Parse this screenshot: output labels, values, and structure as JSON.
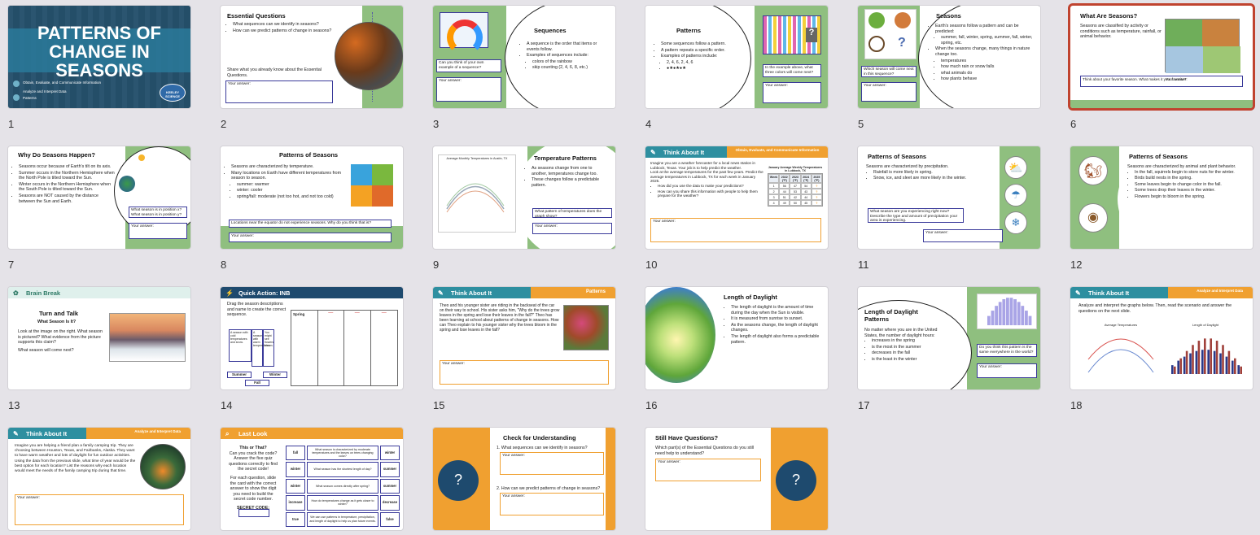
{
  "slides": [
    {
      "n": "1",
      "title": "PATTERNS OF CHANGE IN SEASONS",
      "std": "Obtain, Evaluate, and Communicate Information",
      "std2": "Analyze and Interpret Data",
      "std3": "Patterns",
      "logo": "KEELEY SCIENCE"
    },
    {
      "n": "2",
      "title": "Essential Questions",
      "b1": "What sequences can we identify in seasons?",
      "b2": "How can we predict patterns of change in seasons?",
      "p": "Share what you already know about the Essential Questions.",
      "ans": "Your answer:"
    },
    {
      "n": "3",
      "title": "Sequences",
      "b1": "A sequence is the order that items or events follow.",
      "b2": "Examples of sequences include:",
      "b3": "colors of the rainbow",
      "b4": "skip counting (2, 4, 6, 8, etc.)",
      "q": "Can you think of your own example of a sequence?",
      "ans": "Your answer:"
    },
    {
      "n": "4",
      "title": "Patterns",
      "b1": "Some sequences follow a pattern.",
      "b2": "A pattern repeats a specific order.",
      "b3": "Examples of patterns include:",
      "b4": "2, 4, 6, 2, 4, 6",
      "b5": "●★●★●★",
      "q": "In the example above, what three colors will come next?",
      "ans": "Your answer:"
    },
    {
      "n": "5",
      "title": "Seasons",
      "b1": "Earth's seasons follow a pattern and can be predicted:",
      "b2": "summer, fall, winter, spring, summer, fall, winter, spring, etc.",
      "b3": "When the seasons change, many things in nature change too.",
      "b4": "temperatures",
      "b5": "how much rain or snow falls",
      "b6": "what animals do",
      "b7": "how plants behave",
      "q": "Which season will come next in this sequence?",
      "ans": "Your answer:"
    },
    {
      "n": "6",
      "title": "What Are Seasons?",
      "p": "Seasons are classified by activity or conditions such as temperature, rainfall, or animal behavior.",
      "q": "Think about your favorite season. What makes it your favorite?",
      "ans": "Your answer:"
    },
    {
      "n": "7",
      "title": "Why Do Seasons Happen?",
      "b1": "Seasons occur because of Earth's tilt on its axis.",
      "b2": "Summer occurs in the Northern Hemisphere when the North Pole is tilted toward the Sun.",
      "b3": "Winter occurs in the Northern Hemisphere when the South Pole is tilted toward the Sun.",
      "b4": "Seasons are NOT caused by the distance between the Sun and Earth.",
      "q": "What season is in position x? What season is in position y?",
      "ans": "Your answer:"
    },
    {
      "n": "8",
      "title": "Patterns of Seasons",
      "b1": "Seasons are characterized by temperature.",
      "b2": "Many locations on Earth have different temperatures from season to season.",
      "b3": "summer: warmer",
      "b4": "winter: cooler",
      "b5": "spring/fall: moderate (not too hot, and not too cold)",
      "q": "Locations near the equator do not experience seasons. Why do you think that is?",
      "ans": "Your answer:"
    },
    {
      "n": "9",
      "title": "Temperature Patterns",
      "b1": "As seasons change from one to another, temperatures change too.",
      "b2": "These changes follow a predictable pattern.",
      "ct": "Average Monthly Temperatures in Austin, TX",
      "q": "What pattern of temperatures does the graph show?",
      "ans": "Your answer:"
    },
    {
      "n": "10",
      "hdr": "Think About It",
      "hdr2": "Obtain, Evaluate, and Communicate Information",
      "p": "Imagine you are a weather forecaster for a local news station in Lubbock, Texas. Your job is to help predict the weather.",
      "p2": "Look at the average temperatures for the past few years. Predict the average temperatures in Lubbock, TX for each week in January 2025.",
      "b1": "How did you use the data to make your predictions?",
      "b2": "How can you share this information with people to help them prepare for the weather?",
      "tt": "January Average Weekly Temperatures in Lubbock, TX",
      "th": [
        "Week",
        "2022 (°F)",
        "2023 (°F)",
        "2024 (°F)",
        "2025 (°F)"
      ],
      "rows": [
        [
          "1",
          "56",
          "47",
          "54",
          "?"
        ],
        [
          "2",
          "44",
          "53",
          "43",
          "?"
        ],
        [
          "3",
          "51",
          "42",
          "44",
          "?"
        ],
        [
          "4",
          "49",
          "50",
          "45",
          "?"
        ]
      ],
      "ans": "Your answer:"
    },
    {
      "n": "11",
      "title": "Patterns of Seasons",
      "p": "Seasons are characterized by precipitation.",
      "b1": "Rainfall is more likely in spring.",
      "b2": "Snow, ice, and sleet are more likely in the winter.",
      "q": "What season are you experiencing right now? Describe the type and amount of precipitation your area is experiencing.",
      "ans": "Your answer:"
    },
    {
      "n": "12",
      "title": "Patterns of Seasons",
      "p": "Seasons are characterized by animal and plant behavior.",
      "b1": "In the fall, squirrels begin to store nuts for the winter.",
      "b2": "Birds build nests in the spring.",
      "b3": "Some leaves begin to change color in the fall.",
      "b4": "Some trees drop their leaves in the winter.",
      "b5": "Flowers begin to bloom in the spring."
    },
    {
      "n": "13",
      "hdr": "Brain Break",
      "title": "Turn and Talk",
      "sub": "What Season Is It?",
      "p": "Look at the image on the right. What season is pictured? What evidence from the picture supports this claim?",
      "p2": "What season will come next?"
    },
    {
      "n": "14",
      "hdr": "Quick Action: INB",
      "p": "Drag the season descriptions and name to create the correct sequence.",
      "c1": "A season with cold temperatures and snow.",
      "c2": "A season with warm temperatures.",
      "c3": "You might see flowers bloom.",
      "s1": "Spring",
      "s2": "Summer",
      "s3": "Winter",
      "s4": "Fall"
    },
    {
      "n": "15",
      "hdr": "Think About It",
      "hdr2": "Patterns",
      "p": "Theo and his younger sister are riding in the backseat of the car on their way to school. His sister asks him, \"Why do the trees grow leaves in the spring and lose their leaves in the fall?\" Theo has been learning at school about patterns of change in seasons. How can Theo explain to his younger sister why the trees bloom in the spring and lose leaves in the fall?",
      "ans": "Your answer:"
    },
    {
      "n": "16",
      "title": "Length of Daylight",
      "b1": "The length of daylight is the amount of time during the day when the Sun is visible.",
      "b2": "It is measured from sunrise to sunset.",
      "b3": "As the seasons change, the length of daylight changes.",
      "b4": "The length of daylight also forms a predictable pattern."
    },
    {
      "n": "17",
      "title": "Length of Daylight Patterns",
      "p": "No matter where you are in the United States, the number of daylight hours:",
      "b1": "increases in the spring",
      "b2": "is the most in the summer",
      "b3": "decreases in the fall",
      "b4": "is the least in the winter",
      "q": "Do you think this pattern is the same everywhere in the world?",
      "ans": "Your answer:"
    },
    {
      "n": "18",
      "hdr": "Think About It",
      "hdr2": "Analyze and Interpret Data",
      "p": "Analyze and interpret the graphs below. Then, read the scenario and answer the questions on the next slide.",
      "g1": "Average Temperatures",
      "g2": "Length of Daylight"
    },
    {
      "n": "19",
      "hdr": "Think About It",
      "hdr2": "Analyze and Interpret Data",
      "p": "Imagine you are helping a friend plan a family camping trip. They are choosing between Houston, Texas, and Fairbanks, Alaska. They want to have warm weather and lots of daylight for fun outdoor activities.",
      "p2": "Using the data from the previous slide, what time of year would be the best option for each location? List the reasons why each location would meet the needs of the family camping trip during that time.",
      "ans": "Your answer:"
    },
    {
      "n": "20",
      "hdr": "Last Look",
      "t1": "This or That?",
      "p": "Can you crack the code? Answer the five quiz questions correctly to find the secret code!",
      "p2": "For each question, slide the card with the correct answer to show the digit you need to build the secret code number.",
      "sc": "SECRET CODE:",
      "rows": [
        [
          "fall",
          "What season is characterized by moderate temperatures and the leaves on trees changing color?",
          "winter"
        ],
        [
          "winter",
          "What season has the shortest length of day?",
          "summer"
        ],
        [
          "winter",
          "What season comes directly after spring?",
          "summer"
        ],
        [
          "increase",
          "How do temperatures change as it gets closer to winter?",
          "decrease"
        ],
        [
          "true",
          "We can use patterns in temperature, precipitation, and length of daylight to help us plan future events.",
          "false"
        ]
      ]
    },
    {
      "n": "21",
      "title": "Check for Understanding",
      "q1": "1.  What sequences can we identify in seasons?",
      "q2": "2.  How can we predict patterns of change in seasons?",
      "ans": "Your answer:"
    },
    {
      "n": "22",
      "title": "Still Have Questions?",
      "p": "Which part(s) of the Essential Questions do you still need help to understand?",
      "ans": "Your answer:"
    }
  ],
  "colors": {
    "green": "#8fbf7f",
    "orange": "#f0a030",
    "teal": "#2e8fa0",
    "navy": "#1e4a6e",
    "selected": "#c0432f"
  }
}
